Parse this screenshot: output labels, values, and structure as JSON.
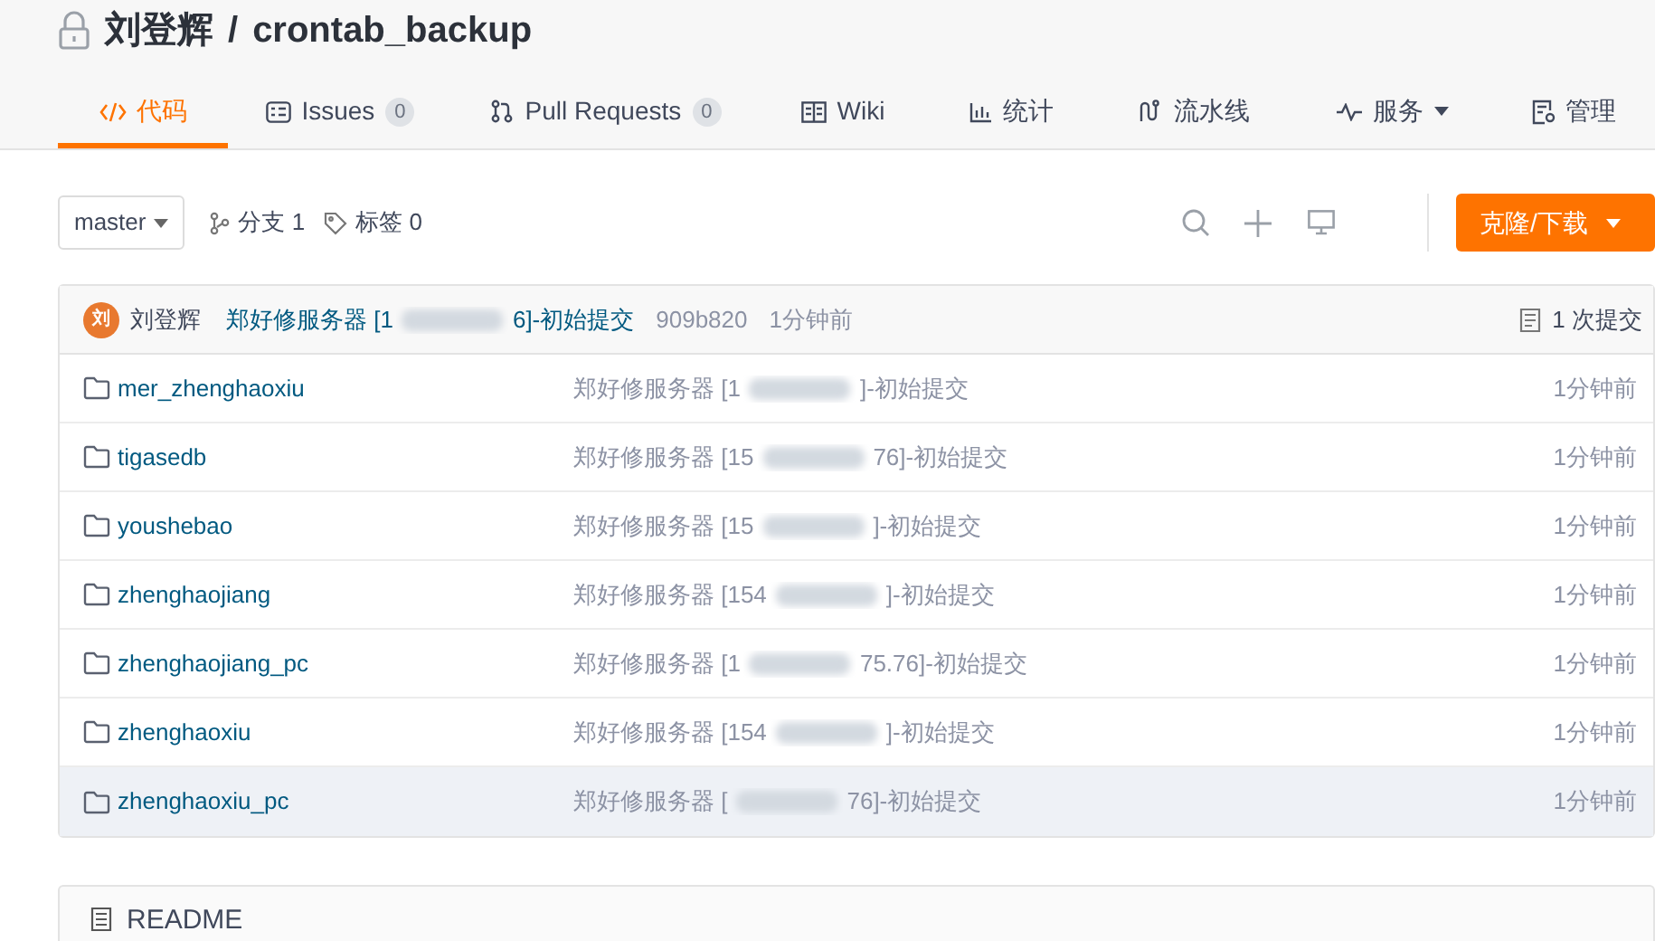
{
  "repo": {
    "owner": "刘登辉",
    "separator": "/",
    "name": "crontab_backup",
    "private": true
  },
  "tabs": [
    {
      "kind": "code",
      "label": "代码",
      "selected": true
    },
    {
      "kind": "issues",
      "label": "Issues",
      "count": "0",
      "selected": false
    },
    {
      "kind": "pulls",
      "label": "Pull Requests",
      "count": "0",
      "selected": false
    },
    {
      "kind": "wiki",
      "label": "Wiki",
      "selected": false
    },
    {
      "kind": "stats",
      "label": "统计",
      "selected": false
    },
    {
      "kind": "pipeline",
      "label": "流水线",
      "selected": false
    },
    {
      "kind": "services",
      "label": "服务",
      "dropdown": true,
      "selected": false
    },
    {
      "kind": "manage",
      "label": "管理",
      "selected": false
    }
  ],
  "toolbar": {
    "branch": "master",
    "branches": "分支 1",
    "tags": "标签 0",
    "clone_button": "克隆/下载"
  },
  "last_commit": {
    "avatar": "刘",
    "author": "刘登辉",
    "message_start": "郑好修服务器 [1",
    "message_end": "6]-初始提交",
    "hash": "909b820",
    "time": "1分钟前",
    "commit_count": "1 次提交"
  },
  "files": [
    {
      "name": "mer_zhenghaoxiu",
      "message_start": "郑好修服务器 [1",
      "message_end": "]-初始提交",
      "time": "1分钟前",
      "selected": false
    },
    {
      "name": "tigasedb",
      "message_start": "郑好修服务器 [15",
      "message_end": "76]-初始提交",
      "time": "1分钟前",
      "selected": false
    },
    {
      "name": "youshebao",
      "message_start": "郑好修服务器 [15",
      "message_end": "]-初始提交",
      "time": "1分钟前",
      "selected": false
    },
    {
      "name": "zhenghaojiang",
      "message_start": "郑好修服务器 [154",
      "message_end": "]-初始提交",
      "time": "1分钟前",
      "selected": false
    },
    {
      "name": "zhenghaojiang_pc",
      "message_start": "郑好修服务器 [1",
      "message_end": "75.76]-初始提交",
      "time": "1分钟前",
      "selected": false
    },
    {
      "name": "zhenghaoxiu",
      "message_start": "郑好修服务器 [154",
      "message_end": "]-初始提交",
      "time": "1分钟前",
      "selected": false
    },
    {
      "name": "zhenghaoxiu_pc",
      "message_start": "郑好修服务器 [",
      "message_end": "76]-初始提交",
      "time": "1分钟前",
      "selected": true
    }
  ],
  "readme": {
    "title": "README"
  }
}
